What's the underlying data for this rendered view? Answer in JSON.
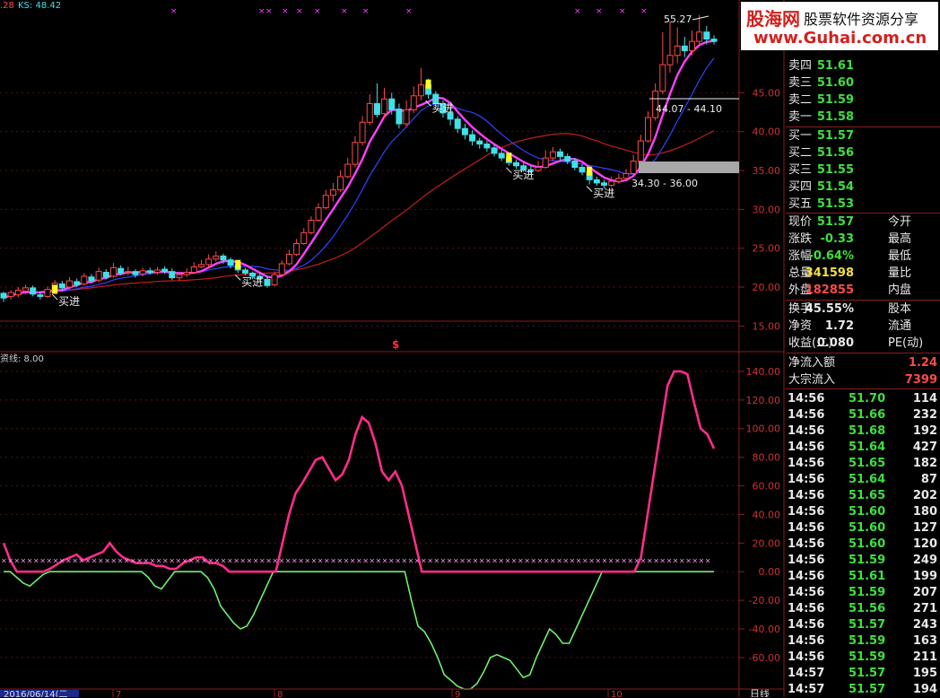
{
  "logo": {
    "brand": "股海网",
    "slogan": "股票软件资源分享",
    "site": "www.Guhai.com.cn"
  },
  "top_indicator": {
    "prefix": ".28",
    "ks_label": "KS: 48.42"
  },
  "sub_indicator_label": "资线: 8.00",
  "price_tags": {
    "high_tag": "55.27",
    "range_upper": "44.07 - 44.10",
    "range_lower": "34.30 - 36.00",
    "dollar_mark": "$"
  },
  "signal_label": "买进",
  "price_axis": [
    "45.00",
    "40.00",
    "35.00",
    "30.00",
    "25.00",
    "20.00",
    "15.00"
  ],
  "osc_axis": [
    "140.00",
    "120.00",
    "100.00",
    "80.00",
    "60.00",
    "40.00",
    "20.00",
    "0.00",
    "-20.00",
    "-40.00",
    "-60.00"
  ],
  "date_axis": {
    "first": "2016/06/14(二",
    "ticks": [
      "7",
      "8",
      "9",
      "10"
    ],
    "period": "日线"
  },
  "colors": {
    "up": "#ff4a4a",
    "down": "#40e0e8",
    "ma5": "#ff40ff",
    "ma10": "#3440ff",
    "ma30": "#c41e1e",
    "green": "#3fe03f",
    "osc_pos": "#ff2d8a",
    "osc_neg": "#6ff06f",
    "border": "#8a1c1c"
  },
  "quote_book": {
    "asks": [
      {
        "label": "卖四",
        "price": "51.61"
      },
      {
        "label": "卖三",
        "price": "51.60"
      },
      {
        "label": "卖二",
        "price": "51.59"
      },
      {
        "label": "卖一",
        "price": "51.58"
      }
    ],
    "bids": [
      {
        "label": "买一",
        "price": "51.57"
      },
      {
        "label": "买二",
        "price": "51.56"
      },
      {
        "label": "买三",
        "price": "51.55"
      },
      {
        "label": "买四",
        "price": "51.54"
      },
      {
        "label": "买五",
        "price": "51.53"
      }
    ]
  },
  "stats": [
    {
      "label": "现价",
      "value": "51.57",
      "label2": "今开"
    },
    {
      "label": "涨跌",
      "value": "-0.33",
      "label2": "最高"
    },
    {
      "label": "涨幅",
      "value": "-0.64%",
      "label2": "最低"
    },
    {
      "label": "总量",
      "value": "341598",
      "label2": "量比"
    },
    {
      "label": "外盘",
      "value": "182855",
      "label2": "内盘"
    }
  ],
  "stats2": [
    {
      "label": "换手",
      "value": "45.55%",
      "label2": "股本"
    },
    {
      "label": "净资",
      "value": "1.72",
      "label2": "流通"
    },
    {
      "label": "收益(二)",
      "value": "0.080",
      "label2": "PE(动)"
    }
  ],
  "flows": [
    {
      "label": "净流入额",
      "value": "1.24"
    },
    {
      "label": "大宗流入",
      "value": "7399"
    }
  ],
  "ticks": [
    {
      "time": "14:56",
      "price": "51.70",
      "vol": "114"
    },
    {
      "time": "14:56",
      "price": "51.66",
      "vol": "232"
    },
    {
      "time": "14:56",
      "price": "51.68",
      "vol": "192"
    },
    {
      "time": "14:56",
      "price": "51.64",
      "vol": "427"
    },
    {
      "time": "14:56",
      "price": "51.65",
      "vol": "182"
    },
    {
      "time": "14:56",
      "price": "51.64",
      "vol": "87"
    },
    {
      "time": "14:56",
      "price": "51.65",
      "vol": "202"
    },
    {
      "time": "14:56",
      "price": "51.60",
      "vol": "180"
    },
    {
      "time": "14:56",
      "price": "51.60",
      "vol": "127"
    },
    {
      "time": "14:56",
      "price": "51.60",
      "vol": "120"
    },
    {
      "time": "14:56",
      "price": "51.59",
      "vol": "249"
    },
    {
      "time": "14:56",
      "price": "51.61",
      "vol": "199"
    },
    {
      "time": "14:56",
      "price": "51.59",
      "vol": "207"
    },
    {
      "time": "14:56",
      "price": "51.56",
      "vol": "271"
    },
    {
      "time": "14:56",
      "price": "51.57",
      "vol": "243"
    },
    {
      "time": "14:56",
      "price": "51.59",
      "vol": "163"
    },
    {
      "time": "14:56",
      "price": "51.59",
      "vol": "211"
    },
    {
      "time": "14:57",
      "price": "51.57",
      "vol": "195"
    },
    {
      "time": "14:57",
      "price": "51.57",
      "vol": "194"
    }
  ],
  "chart_data": {
    "type": "candlestick",
    "price_panel": {
      "ylim": [
        14,
        56
      ],
      "candles": [
        [
          19.2,
          18.6,
          19.4,
          18.1
        ],
        [
          18.8,
          19.3,
          19.6,
          18.4
        ],
        [
          19.0,
          19.6,
          20.0,
          18.7
        ],
        [
          19.5,
          19.9,
          20.3,
          19.1
        ],
        [
          19.9,
          19.1,
          20.2,
          18.8
        ],
        [
          19.0,
          18.8,
          19.4,
          18.4
        ],
        [
          18.8,
          19.7,
          20.1,
          18.6
        ],
        [
          19.6,
          20.5,
          20.9,
          19.3
        ],
        [
          20.4,
          19.9,
          20.8,
          19.6
        ],
        [
          20.0,
          20.8,
          21.3,
          19.7
        ],
        [
          20.7,
          20.3,
          21.1,
          20.0
        ],
        [
          20.4,
          21.4,
          21.8,
          20.2
        ],
        [
          21.3,
          20.8,
          21.7,
          20.5
        ],
        [
          20.9,
          22.0,
          22.5,
          20.6
        ],
        [
          21.9,
          21.3,
          22.3,
          21.0
        ],
        [
          21.4,
          22.5,
          23.1,
          21.2
        ],
        [
          22.4,
          21.8,
          22.8,
          21.5
        ],
        [
          21.9,
          22.0,
          22.6,
          21.5
        ],
        [
          22.0,
          21.6,
          22.3,
          21.2
        ],
        [
          21.7,
          22.1,
          22.5,
          21.4
        ],
        [
          22.1,
          21.9,
          22.5,
          21.6
        ],
        [
          21.9,
          22.2,
          22.6,
          21.6
        ],
        [
          22.3,
          22.0,
          22.7,
          21.7
        ],
        [
          22.0,
          21.2,
          22.4,
          20.9
        ],
        [
          21.2,
          21.6,
          22.0,
          20.8
        ],
        [
          21.6,
          21.9,
          22.4,
          21.3
        ],
        [
          21.9,
          22.6,
          23.2,
          21.7
        ],
        [
          22.6,
          22.9,
          23.5,
          22.4
        ],
        [
          22.9,
          23.6,
          24.2,
          22.6
        ],
        [
          23.6,
          24.0,
          24.6,
          23.3
        ],
        [
          24.0,
          23.5,
          24.3,
          23.0
        ],
        [
          23.5,
          22.8,
          23.8,
          22.4
        ],
        [
          22.8,
          22.2,
          23.0,
          21.8
        ],
        [
          22.2,
          21.8,
          22.5,
          21.5
        ],
        [
          21.8,
          21.4,
          22.0,
          21.0
        ],
        [
          21.4,
          21.1,
          21.8,
          20.8
        ],
        [
          21.0,
          20.2,
          21.4,
          19.9
        ],
        [
          20.3,
          21.6,
          22.0,
          20.1
        ],
        [
          21.6,
          23.0,
          23.4,
          21.4
        ],
        [
          23.0,
          24.2,
          24.8,
          22.8
        ],
        [
          24.2,
          25.6,
          26.2,
          24.0
        ],
        [
          25.6,
          27.0,
          27.6,
          25.4
        ],
        [
          27.0,
          28.6,
          29.1,
          26.8
        ],
        [
          28.6,
          30.2,
          30.8,
          28.4
        ],
        [
          30.2,
          31.8,
          32.5,
          30.0
        ],
        [
          31.8,
          32.5,
          33.4,
          31.0
        ],
        [
          32.5,
          34.2,
          35.0,
          32.2
        ],
        [
          34.2,
          35.8,
          36.6,
          34.0
        ],
        [
          35.8,
          38.6,
          39.4,
          35.4
        ],
        [
          38.6,
          41.2,
          42.0,
          38.2
        ],
        [
          41.2,
          43.6,
          44.8,
          40.8
        ],
        [
          43.6,
          42.2,
          46.2,
          41.8
        ],
        [
          42.3,
          44.2,
          45.6,
          41.8
        ],
        [
          44.2,
          42.8,
          45.0,
          42.2
        ],
        [
          42.9,
          41.0,
          43.6,
          40.4
        ],
        [
          41.0,
          42.8,
          44.0,
          40.6
        ],
        [
          42.8,
          44.6,
          45.8,
          42.4
        ],
        [
          44.6,
          46.0,
          48.2,
          44.0
        ],
        [
          46.0,
          44.8,
          46.8,
          44.2
        ],
        [
          44.8,
          43.6,
          45.2,
          43.0
        ],
        [
          43.6,
          42.4,
          44.0,
          41.8
        ],
        [
          42.4,
          41.6,
          43.0,
          40.8
        ],
        [
          41.6,
          40.4,
          42.0,
          39.8
        ],
        [
          40.4,
          39.6,
          41.0,
          39.0
        ],
        [
          39.6,
          38.8,
          40.2,
          38.2
        ],
        [
          38.8,
          38.4,
          39.2,
          37.8
        ],
        [
          38.4,
          37.9,
          38.8,
          37.4
        ],
        [
          37.9,
          37.2,
          38.3,
          36.8
        ],
        [
          37.2,
          36.6,
          37.6,
          36.2
        ],
        [
          36.6,
          36.0,
          37.0,
          35.6
        ],
        [
          36.0,
          35.6,
          36.4,
          35.2
        ],
        [
          35.6,
          35.1,
          36.0,
          34.8
        ],
        [
          35.1,
          35.0,
          35.6,
          34.6
        ],
        [
          35.0,
          35.4,
          36.2,
          34.8
        ],
        [
          35.4,
          36.6,
          37.6,
          35.2
        ],
        [
          36.6,
          37.4,
          38.0,
          36.2
        ],
        [
          37.4,
          36.8,
          37.8,
          36.2
        ],
        [
          36.8,
          36.2,
          37.2,
          35.8
        ],
        [
          36.2,
          35.4,
          36.6,
          35.0
        ],
        [
          35.4,
          34.8,
          35.8,
          34.4
        ],
        [
          34.8,
          33.8,
          35.2,
          33.2
        ],
        [
          33.8,
          33.4,
          34.2,
          33.0
        ],
        [
          33.4,
          33.1,
          33.8,
          32.7
        ],
        [
          33.1,
          33.6,
          34.2,
          32.9
        ],
        [
          33.6,
          34.0,
          34.6,
          33.3
        ],
        [
          34.0,
          34.6,
          35.2,
          33.8
        ],
        [
          34.6,
          36.2,
          37.0,
          34.4
        ],
        [
          36.2,
          38.8,
          39.6,
          36.0
        ],
        [
          38.8,
          41.8,
          42.6,
          38.6
        ],
        [
          41.8,
          45.2,
          46.2,
          41.4
        ],
        [
          45.2,
          48.6,
          52.8,
          44.8
        ],
        [
          48.6,
          49.8,
          54.2,
          47.6
        ],
        [
          49.8,
          51.0,
          53.4,
          48.8
        ],
        [
          51.0,
          50.4,
          52.2,
          49.6
        ],
        [
          50.4,
          51.6,
          53.0,
          49.8
        ],
        [
          51.6,
          52.8,
          55.0,
          51.0
        ],
        [
          52.8,
          51.9,
          53.6,
          51.2
        ],
        [
          51.9,
          51.6,
          52.4,
          51.2
        ]
      ]
    },
    "oscillator": {
      "ylim": [
        -82,
        150
      ],
      "threshold": 8,
      "positive": [
        20,
        8,
        0,
        0,
        0,
        0,
        0,
        2,
        5,
        8,
        10,
        12,
        8,
        10,
        12,
        14,
        20,
        14,
        10,
        8,
        6,
        6,
        6,
        4,
        4,
        2,
        2,
        6,
        8,
        10,
        10,
        6,
        6,
        4,
        0,
        0,
        0,
        0,
        0,
        0,
        0,
        0,
        20,
        40,
        55,
        62,
        70,
        78,
        80,
        72,
        64,
        68,
        78,
        96,
        108,
        104,
        90,
        70,
        64,
        70,
        60,
        40,
        20,
        0,
        0,
        0,
        0,
        0,
        0,
        0,
        0,
        0,
        0,
        0,
        0,
        0,
        0,
        0,
        0,
        0,
        0,
        0,
        0,
        0,
        0,
        0,
        0,
        0,
        0,
        0,
        0,
        0,
        0,
        0,
        0,
        0,
        10,
        40,
        70,
        100,
        130,
        140,
        140,
        138,
        118,
        100,
        96,
        86
      ],
      "negative": [
        0,
        0,
        -4,
        -8,
        -10,
        -6,
        -2,
        0,
        0,
        0,
        0,
        0,
        0,
        0,
        0,
        0,
        0,
        0,
        0,
        0,
        0,
        0,
        -4,
        -10,
        -12,
        -6,
        0,
        0,
        0,
        0,
        0,
        -4,
        -12,
        -24,
        -30,
        -36,
        -40,
        -38,
        -30,
        -20,
        -10,
        0,
        0,
        0,
        0,
        0,
        0,
        0,
        0,
        0,
        0,
        0,
        0,
        0,
        0,
        0,
        0,
        0,
        0,
        0,
        0,
        0,
        -20,
        -38,
        -42,
        -50,
        -60,
        -72,
        -76,
        -80,
        -82,
        -82,
        -78,
        -70,
        -60,
        -58,
        -60,
        -62,
        -68,
        -74,
        -72,
        -60,
        -50,
        -40,
        -44,
        -50,
        -50,
        -40,
        -30,
        -20,
        -10,
        0,
        0,
        0,
        0,
        0,
        0,
        0,
        0,
        0,
        0,
        0,
        0,
        0,
        0,
        0,
        0,
        0,
        0
      ]
    }
  }
}
